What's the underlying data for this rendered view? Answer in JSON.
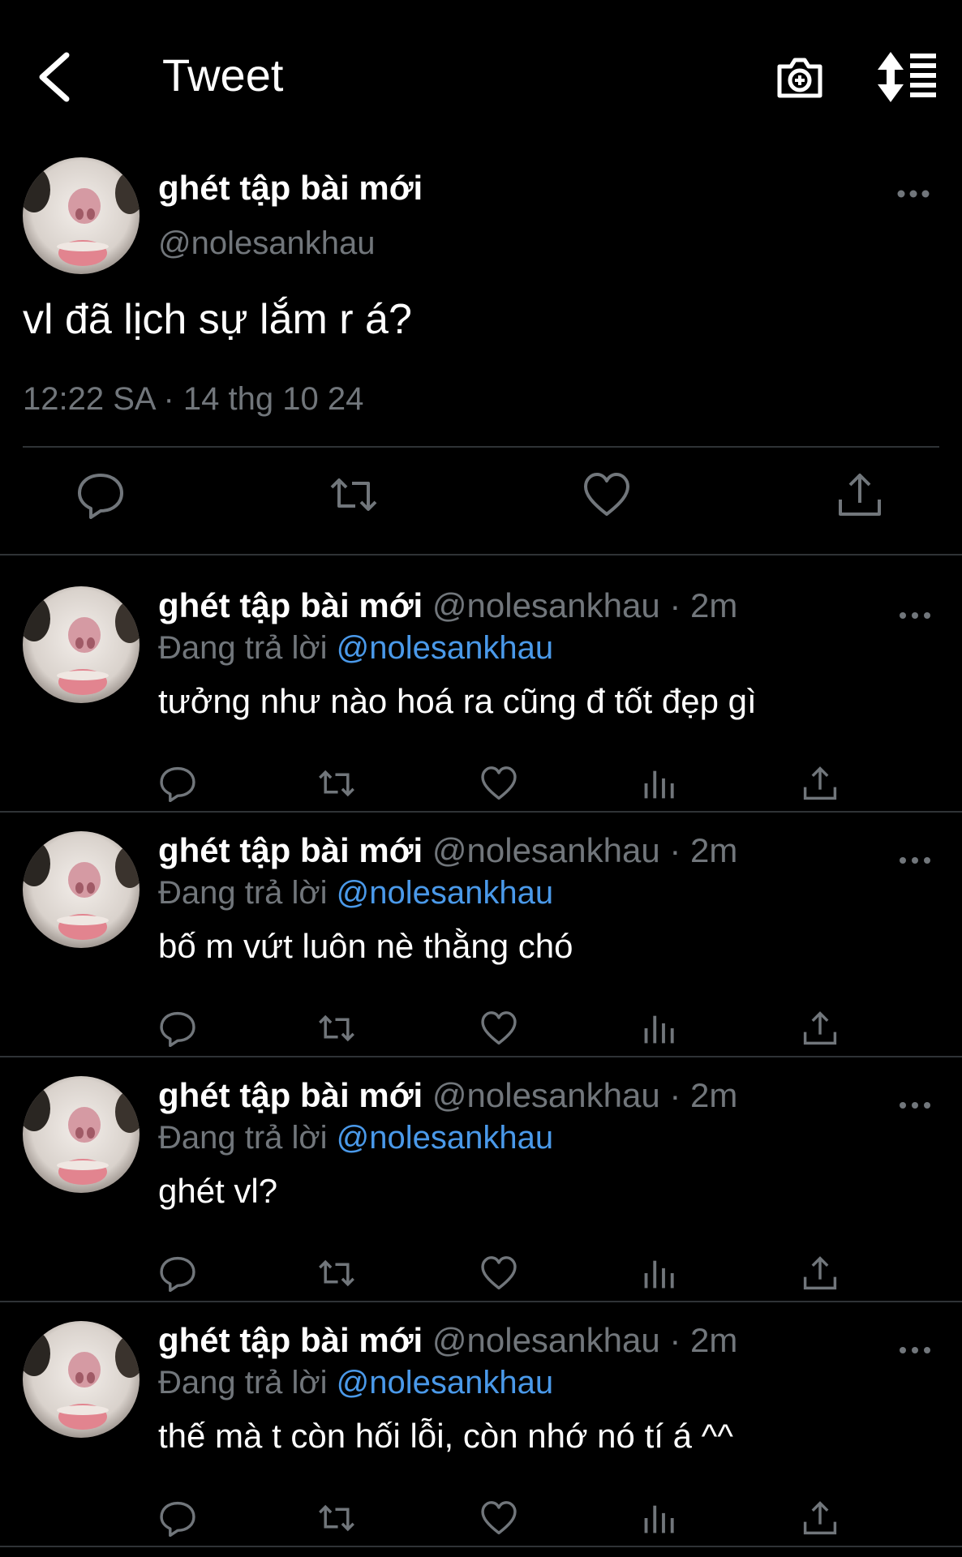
{
  "header": {
    "title": "Tweet",
    "icons": [
      "back-icon",
      "camera-plus-icon",
      "sort-icon"
    ]
  },
  "tweet": {
    "author_name": "ghét tập bài mới",
    "author_handle": "@nolesankhau",
    "text": "vl đã lịch sự lắm r á?",
    "timestamp": "12:22 SA · 14 thg 10 24",
    "actions": [
      "reply-icon",
      "retweet-icon",
      "like-icon",
      "share-icon"
    ]
  },
  "replies": [
    {
      "name": "ghét tập bài mới",
      "meta": "@nolesankhau · 2m",
      "replying_prefix": "Đang trả lời",
      "replying_to": "@nolesankhau",
      "text": "tưởng như nào hoá ra cũng đ tốt đẹp gì"
    },
    {
      "name": "ghét tập bài mới",
      "meta": "@nolesankhau · 2m",
      "replying_prefix": "Đang trả lời",
      "replying_to": "@nolesankhau",
      "text": "bố m vứt luôn nè thằng chó"
    },
    {
      "name": "ghét tập bài mới",
      "meta": "@nolesankhau · 2m",
      "replying_prefix": "Đang trả lời",
      "replying_to": "@nolesankhau",
      "text": "ghét vl?"
    },
    {
      "name": "ghét tập bài mới",
      "meta": "@nolesankhau · 2m",
      "replying_prefix": "Đang trả lời",
      "replying_to": "@nolesankhau",
      "text": "thế mà t còn hối lỗi, còn nhớ nó tí á ^^"
    }
  ],
  "colors": {
    "background": "#000000",
    "text": "#ffffff",
    "secondary": "#71767b",
    "link": "#4a99e9",
    "divider": "#2f3336"
  }
}
